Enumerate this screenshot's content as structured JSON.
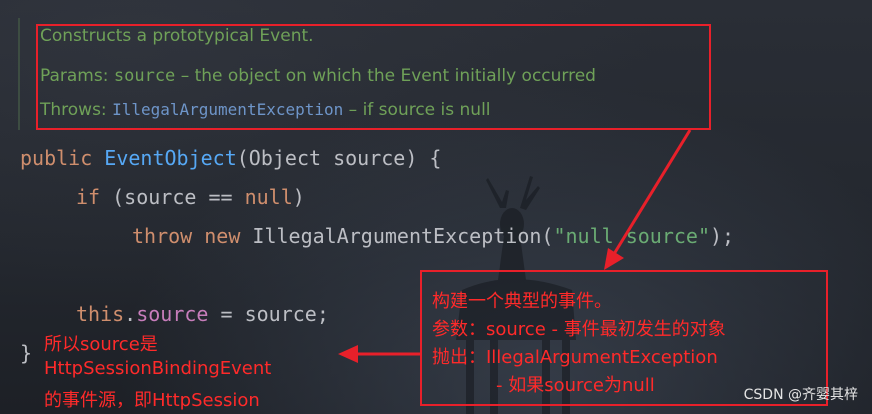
{
  "doc": {
    "summary": "Constructs a prototypical Event.",
    "params_label": "Params:",
    "params_name": "source",
    "params_desc": " – the object on which the Event initially occurred",
    "throws_label": "Throws:",
    "throws_type": "IllegalArgumentException",
    "throws_desc": " – if source is null"
  },
  "code": {
    "l1_public": "public ",
    "l1_method": "EventObject",
    "l1_rest": "(Object source) {",
    "l2_if": "if",
    "l2_cond": " (source == ",
    "l2_null": "null",
    "l2_close": ")",
    "l3_throw": "throw",
    "l3_new": " new",
    "l3_type": " IllegalArgumentException(",
    "l3_str": "\"null source\"",
    "l3_end": ");",
    "l5_this": "this",
    "l5_dot": ".",
    "l5_field": "source",
    "l5_rest": " = source;",
    "l6_brace": "}"
  },
  "notes": {
    "right": {
      "line1": "构建一个典型的事件。",
      "line2": "参数：source - 事件最初发生的对象",
      "line3": "抛出：IllegalArgumentException",
      "line4": "- 如果source为null"
    },
    "left": {
      "line1": "所以source是",
      "line2": "HttpSessionBindingEvent",
      "line3": "的事件源，即HttpSession"
    }
  },
  "watermark": "CSDN @齐婴其梓",
  "colors": {
    "annotation_red": "#e8202a",
    "keyword": "#cf8e6d",
    "method": "#56a8f5",
    "field": "#c77dbb",
    "string": "#6aab73",
    "doc_comment": "#6fa158"
  }
}
